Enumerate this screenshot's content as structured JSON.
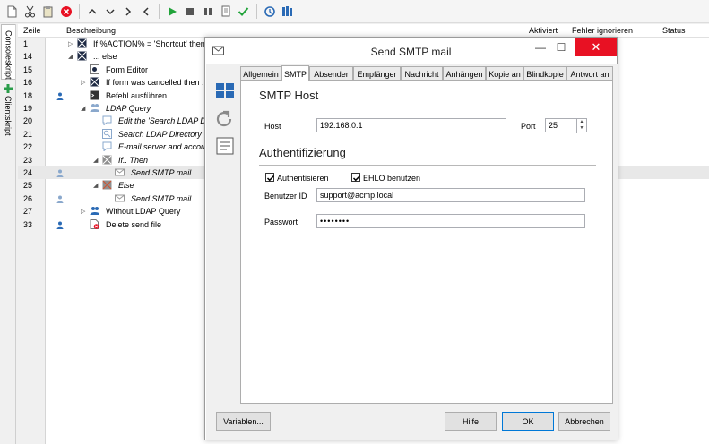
{
  "header": {
    "zeile": "Zeile",
    "beschreibung": "Beschreibung",
    "aktiviert": "Aktiviert",
    "fehler": "Fehler ignorieren",
    "status": "Status"
  },
  "vtabs": {
    "console": "Consoleskript",
    "client": "Clientskript"
  },
  "rows": [
    {
      "num": "1",
      "text": "If %ACTION% = 'Shortcut' then"
    },
    {
      "num": "14",
      "text": "... else"
    },
    {
      "num": "15",
      "text": "Form Editor"
    },
    {
      "num": "16",
      "text": "If form was cancelled then ..."
    },
    {
      "num": "18",
      "text": "Befehl ausführen"
    },
    {
      "num": "19",
      "text": "LDAP Query"
    },
    {
      "num": "20",
      "text": "Edit the 'Search LDAP Dir"
    },
    {
      "num": "21",
      "text": "Search LDAP Directory"
    },
    {
      "num": "22",
      "text": "E-mail server and accour"
    },
    {
      "num": "23",
      "text": "If.. Then"
    },
    {
      "num": "24",
      "text": "Send SMTP mail"
    },
    {
      "num": "25",
      "text": "Else"
    },
    {
      "num": "26",
      "text": "Send SMTP mail"
    },
    {
      "num": "27",
      "text": "Without LDAP Query"
    },
    {
      "num": "33",
      "text": "Delete send file"
    }
  ],
  "dialog": {
    "title": "Send SMTP mail",
    "minimize": "—",
    "maximize": "☐",
    "close": "✕",
    "tabs": [
      "Allgemein",
      "SMTP",
      "Absender",
      "Empfänger",
      "Nachricht",
      "Anhängen",
      "Kopie an",
      "Blindkopie",
      "Antwort an"
    ],
    "smtp_host_title": "SMTP Host",
    "host_label": "Host",
    "host_value": "192.168.0.1",
    "port_label": "Port",
    "port_value": "25",
    "auth_title": "Authentifizierung",
    "auth_checkbox": "Authentisieren",
    "ehlo_checkbox": "EHLO benutzen",
    "user_label": "Benutzer ID",
    "user_value": "support@acmp.local",
    "password_label": "Passwort",
    "password_value": "••••••••",
    "variables_button": "Variablen...",
    "help_button": "Hilfe",
    "ok_button": "OK",
    "cancel_button": "Abbrechen"
  },
  "colors": {
    "accent": "#0078d7",
    "close_red": "#e81123",
    "play_green": "#21a33a"
  }
}
